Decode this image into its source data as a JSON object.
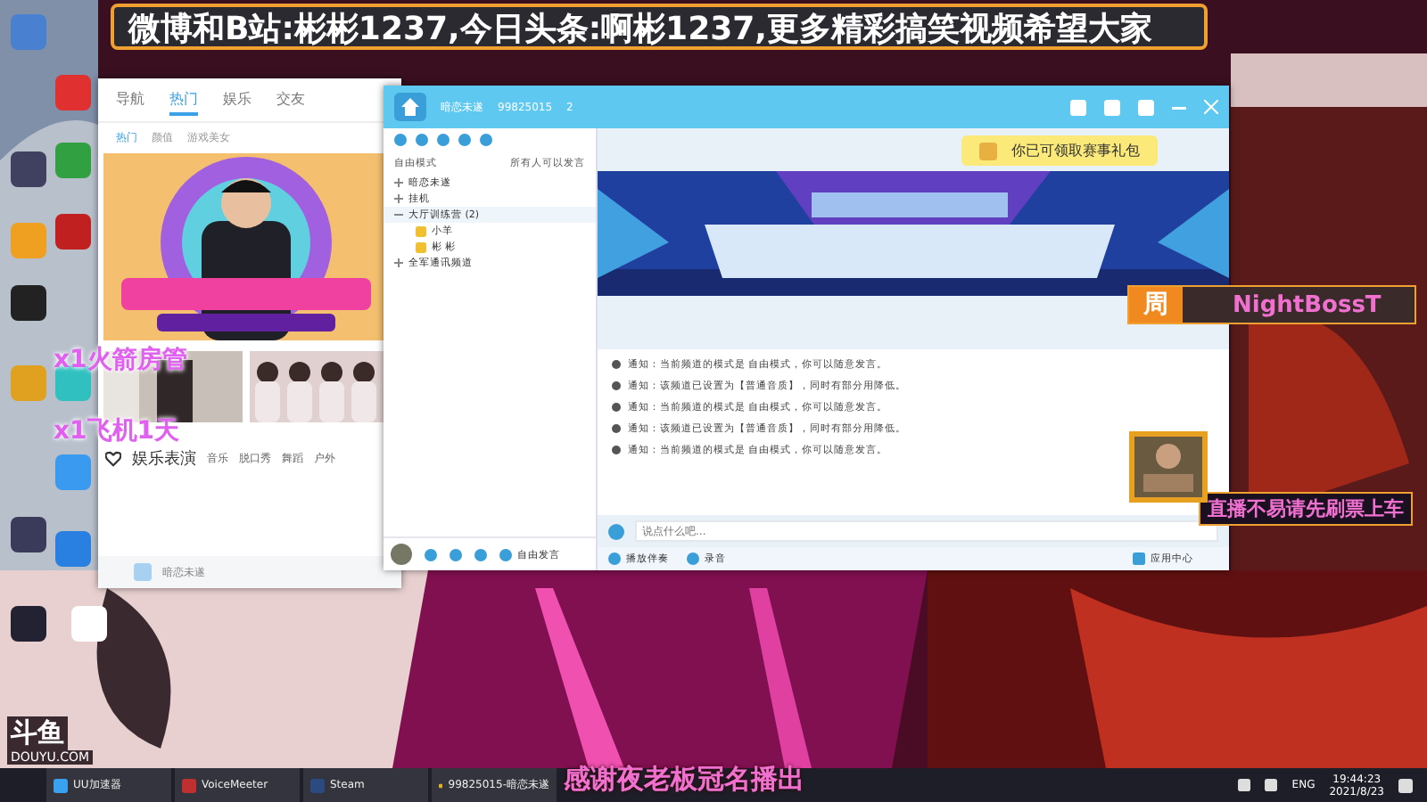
{
  "overlay": {
    "top_banner": "微博和B站:彬彬1237,今日头条:啊彬1237,更多精彩搞笑视频希望大家",
    "host_tag": "周",
    "host_name": "NightBossT",
    "notice": "直播不易请先刷票上车",
    "sponsor": "感谢夜老板冠名播出",
    "gift_lines": [
      "x1火箭房管",
      "x1飞机1天"
    ],
    "logo": "斗鱼",
    "logo_sub": "DOUYU.COM"
  },
  "browser": {
    "tabs": [
      {
        "label": "导航",
        "selected": false
      },
      {
        "label": "热门",
        "selected": true
      },
      {
        "label": "娱乐",
        "selected": false
      },
      {
        "label": "交友",
        "selected": false
      }
    ],
    "subtabs": [
      {
        "label": "热门",
        "selected": true
      },
      {
        "label": "颜值",
        "selected": false
      },
      {
        "label": "游戏美女",
        "selected": false
      }
    ],
    "section": {
      "title": "娱乐表演",
      "tags": [
        "音乐",
        "脱口秀",
        "舞蹈",
        "户外"
      ]
    },
    "footer": "暗恋未遂"
  },
  "yy": {
    "channel": "暗恋未遂",
    "room_id": "99825015",
    "online": "2",
    "mode": "自由模式",
    "mode_hint": "所有人可以发言",
    "tree": [
      {
        "label": "暗恋未遂",
        "expanded": false
      },
      {
        "label": "挂机",
        "expanded": false
      },
      {
        "label": "大厅训练营",
        "count": "(2)",
        "expanded": true,
        "children": [
          {
            "label": "小羊"
          },
          {
            "label": "彬 彬"
          }
        ]
      },
      {
        "label": "全军通讯频道",
        "expanded": false
      }
    ],
    "toast": "你已可领取赛事礼包",
    "messages": [
      "通知：当前频道的模式是 自由模式，你可以随意发言。",
      "通知：该频道已设置为【普通音质】，同时有部分用降低。",
      "通知：当前频道的模式是 自由模式，你可以随意发言。",
      "通知：该频道已设置为【普通音质】，同时有部分用降低。",
      "通知：当前频道的模式是 自由模式，你可以随意发言。"
    ],
    "input": {
      "placeholder": "说点什么吧..."
    },
    "speak_mode": "自由发言",
    "bottom": [
      "播放伴奏",
      "录音"
    ],
    "app_center": "应用中心"
  },
  "taskbar": {
    "items": [
      "UU加速器",
      "VoiceMeeter",
      "Steam",
      "99825015-暗恋未遂"
    ],
    "language": "ENG",
    "time": "19:44:23",
    "date": "2021/8/23"
  }
}
